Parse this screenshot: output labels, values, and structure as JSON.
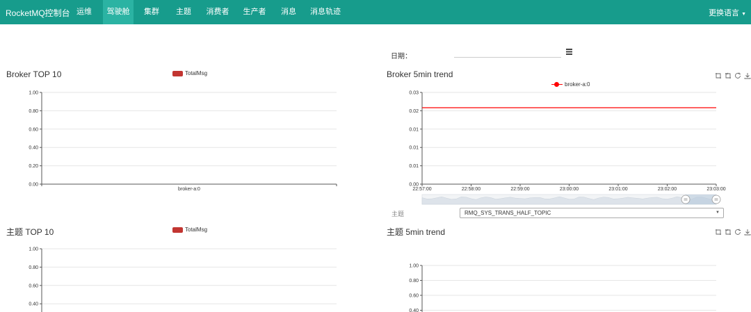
{
  "nav": {
    "brand": "RocketMQ控制台",
    "items": [
      {
        "label": "运维"
      },
      {
        "label": "驾驶舱"
      },
      {
        "label": "集群"
      },
      {
        "label": "主题"
      },
      {
        "label": "消费者"
      },
      {
        "label": "生产者"
      },
      {
        "label": "消息"
      },
      {
        "label": "消息轨迹"
      }
    ],
    "active": "驾驶舱",
    "language": "更换语言"
  },
  "date_filter": {
    "label": "日期：",
    "value": ""
  },
  "topic_filter": {
    "label": "主题",
    "selected": "RMQ_SYS_TRANS_HALF_TOPIC"
  },
  "colors": {
    "navbar": "#179c8c",
    "bar_series": "#c23531",
    "trend_line": "#ff0000"
  },
  "toolbox_icons": [
    "zoom-icon",
    "zoom-reset-icon",
    "restore-icon",
    "download-icon"
  ],
  "chart_data": [
    {
      "type": "bar",
      "title": "Broker TOP 10",
      "legend": [
        "TotalMsg"
      ],
      "categories": [
        "broker-a:0"
      ],
      "series": [
        {
          "name": "TotalMsg",
          "values": [
            0
          ]
        }
      ],
      "yticks": [
        "1.00",
        "0.80",
        "0.60",
        "0.40",
        "0.20",
        "0.00"
      ],
      "ylim": [
        0,
        1
      ],
      "grid": true
    },
    {
      "type": "line",
      "title": "Broker 5min trend",
      "legend": [
        "broker-a:0"
      ],
      "x": [
        "22:57:00",
        "22:58:00",
        "22:59:00",
        "23:00:00",
        "23:01:00",
        "23:02:00",
        "23:03:00"
      ],
      "series": [
        {
          "name": "broker-a:0",
          "values": [
            0.025,
            0.025,
            0.025,
            0.025,
            0.025,
            0.025,
            0.025
          ]
        }
      ],
      "yticks": [
        "0.03",
        "0.02",
        "0.01",
        "0.01",
        "0.01",
        "0.00"
      ],
      "ylim": [
        0,
        0.03
      ],
      "grid": true,
      "zoom_slider": true
    },
    {
      "type": "bar",
      "title": "主题 TOP 10",
      "legend": [
        "TotalMsg"
      ],
      "categories": [],
      "series": [
        {
          "name": "TotalMsg",
          "values": []
        }
      ],
      "yticks": [
        "1.00",
        "0.80",
        "0.60",
        "0.40"
      ],
      "ylim": [
        0,
        1
      ],
      "grid": true
    },
    {
      "type": "line",
      "title": "主题 5min trend",
      "legend": [],
      "x": [],
      "series": [],
      "yticks": [
        "1.00",
        "0.80",
        "0.60",
        "0.40"
      ],
      "ylim": [
        0,
        1
      ],
      "grid": true
    }
  ]
}
